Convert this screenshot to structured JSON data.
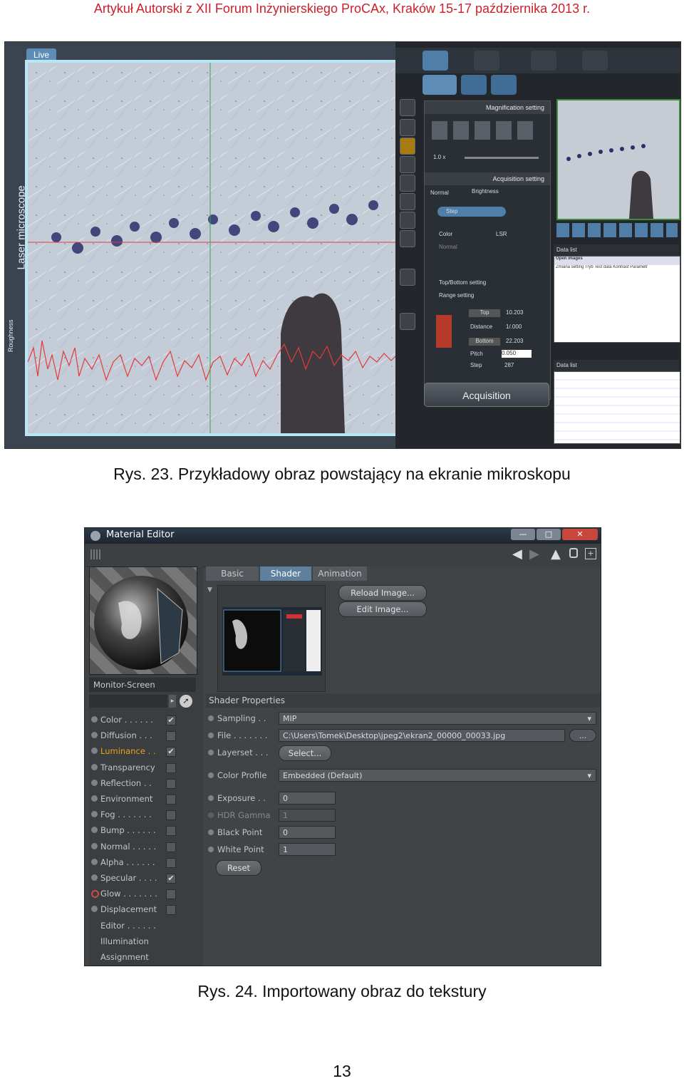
{
  "page": {
    "header": "Artykuł Autorski z XII Forum Inżynierskiego ProCAx, Kraków 15-17 października 2013 r.",
    "caption1": "Rys. 23. Przykładowy obraz powstający na ekranie mikroskopu",
    "caption2": "Rys. 24. Importowany obraz do tekstury",
    "page_number": "13"
  },
  "microscope": {
    "live_tab": "Live",
    "side_label": "Laser microscope",
    "side_label2": "Roughness",
    "magnification_title": "Magnification setting",
    "magnification_value": "1.0 x",
    "acquisition_title": "Acquisition setting",
    "tab_normal": "Normal",
    "tab_brightness": "Brightness",
    "mode_value": "Step",
    "opt_color": "Color",
    "opt_lsr": "LSR",
    "opt_normal": "Normal",
    "topbottom": "Top/Bottom setting",
    "range": "Range setting",
    "top_label": "Top",
    "top_value": "10.203",
    "distance_label": "Distance",
    "distance_value": "1/.000",
    "bottom_label": "Bottom",
    "bottom_value": "22.203",
    "pitch_label": "Pitch",
    "pitch_value": "0.050",
    "step_label": "Step",
    "step_value": "287",
    "acquisition_button": "Acquisition",
    "data_list": "Data list",
    "open_images": "Open images",
    "data_list_text": "Zmiana setting Tryb Test data Kontrast Parametr",
    "data_list2": "Data list",
    "colors": {
      "live_border": "#b7e7f4",
      "profile_line": "#e23b3b",
      "cursor_line": "#2fa84f"
    }
  },
  "material_editor": {
    "title": "Material Editor",
    "material_name": "Monitor-Screen",
    "tabs": [
      "Basic",
      "Shader",
      "Animation"
    ],
    "active_tab": "Shader",
    "reload_button": "Reload Image...",
    "edit_button": "Edit Image...",
    "section_title": "Shader Properties",
    "channels": [
      {
        "label": "Color . . . . . .",
        "checked": true,
        "active": false
      },
      {
        "label": "Diffusion . . .",
        "checked": false,
        "active": false
      },
      {
        "label": "Luminance . .",
        "checked": true,
        "active": true
      },
      {
        "label": "Transparency",
        "checked": false,
        "active": false
      },
      {
        "label": "Reflection . .",
        "checked": false,
        "active": false
      },
      {
        "label": "Environment",
        "checked": false,
        "active": false
      },
      {
        "label": "Fog . . . . . . .",
        "checked": false,
        "active": false
      },
      {
        "label": "Bump . . . . . .",
        "checked": false,
        "active": false
      },
      {
        "label": "Normal . . . . .",
        "checked": false,
        "active": false
      },
      {
        "label": "Alpha . . . . . .",
        "checked": false,
        "active": false
      },
      {
        "label": "Specular . . . .",
        "checked": true,
        "active": false
      },
      {
        "label": "Glow . . . . . . .",
        "checked": false,
        "active": false
      },
      {
        "label": "Displacement",
        "checked": false,
        "active": false
      },
      {
        "label": "Editor . . . . . .",
        "checked": null,
        "active": false
      },
      {
        "label": "Illumination",
        "checked": null,
        "active": false
      },
      {
        "label": "Assignment",
        "checked": null,
        "active": false
      }
    ],
    "props": {
      "sampling_label": "Sampling . .",
      "sampling_value": "MIP",
      "file_label": "File . . . . . . .",
      "file_value": "C:\\Users\\Tomek\\Desktop\\jpeg2\\ekran2_00000_00033.jpg",
      "file_browse": "...",
      "layerset_label": "Layerset . . .",
      "select_button": "Select...",
      "color_profile_label": "Color Profile",
      "color_profile_value": "Embedded (Default)",
      "exposure_label": "Exposure . .",
      "exposure_value": "0",
      "hdr_label": "HDR Gamma",
      "hdr_value": "1",
      "black_label": "Black Point",
      "black_value": "0",
      "white_label": "White Point",
      "white_value": "1",
      "reset_button": "Reset"
    },
    "colors": {
      "active_tab": "#5f7f9f",
      "luminance": "#e8a21a"
    }
  }
}
